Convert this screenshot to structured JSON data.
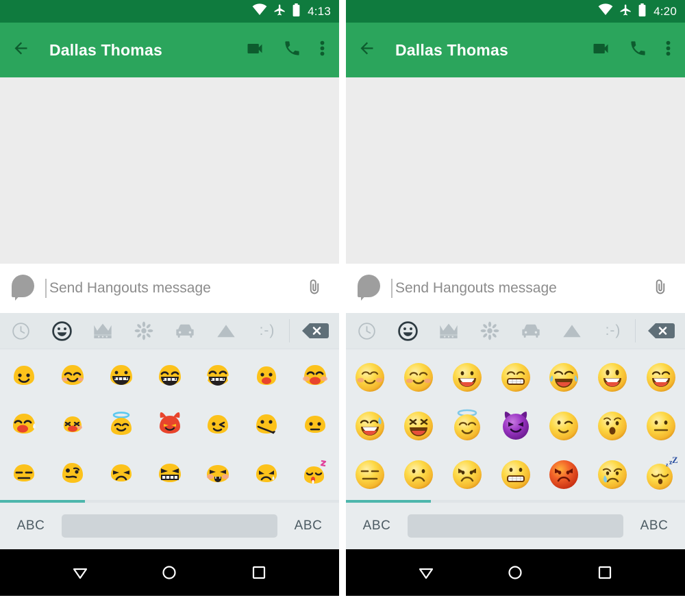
{
  "screens": [
    {
      "id": "left",
      "label": "old-blob-emoji-screen",
      "status": {
        "time": "4:13",
        "wifi_icon": "wifi-icon",
        "airplane_icon": "airplane-mode-icon",
        "battery_icon": "battery-icon"
      },
      "appbar": {
        "back_icon": "back-arrow-icon",
        "title": "Dallas Thomas",
        "video_icon": "video-call-icon",
        "call_icon": "phone-call-icon",
        "overflow_icon": "overflow-menu-icon"
      },
      "compose": {
        "avatar_icon": "avatar-bubble-icon",
        "placeholder": "Send Hangouts message",
        "value": "",
        "attach_icon": "paperclip-icon"
      },
      "keyboard": {
        "categories": [
          {
            "name": "recent-emoji-tab",
            "icon": "clock-icon",
            "active": false
          },
          {
            "name": "smileys-emoji-tab",
            "icon": "smiley-icon",
            "active": true
          },
          {
            "name": "people-emoji-tab",
            "icon": "crown-icon",
            "active": false
          },
          {
            "name": "nature-emoji-tab",
            "icon": "flower-icon",
            "active": false
          },
          {
            "name": "travel-emoji-tab",
            "icon": "car-icon",
            "active": false
          },
          {
            "name": "objects-emoji-tab",
            "icon": "triangle-icon",
            "active": false
          },
          {
            "name": "emoticons-tab",
            "icon": "text-emoticon",
            "label": ":-)",
            "active": false
          }
        ],
        "backspace_icon": "backspace-icon",
        "style": "blob",
        "rows": [
          [
            "slightly-smiling",
            "blush",
            "grin",
            "grin-eyes-closed",
            "joy",
            "open-mouth-smile",
            "laughing-blush"
          ],
          [
            "sweat-smile",
            "squint-laugh",
            "halo",
            "devil-red",
            "wink",
            "zipper-mouth",
            "neutral"
          ],
          [
            "expressionless",
            "confused",
            "angry",
            "grimace-angry",
            "pouting",
            "crying",
            "sleeping"
          ]
        ],
        "left_key_label": "ABC",
        "right_key_label": "ABC",
        "spacebar_label": ""
      },
      "nav": {
        "back_icon": "keyboard-hide-icon",
        "home_icon": "home-circle-icon",
        "recents_icon": "recents-square-icon"
      }
    },
    {
      "id": "right",
      "label": "new-round-emoji-screen",
      "status": {
        "time": "4:20",
        "wifi_icon": "wifi-icon",
        "airplane_icon": "airplane-mode-icon",
        "battery_icon": "battery-icon"
      },
      "appbar": {
        "back_icon": "back-arrow-icon",
        "title": "Dallas Thomas",
        "video_icon": "video-call-icon",
        "call_icon": "phone-call-icon",
        "overflow_icon": "overflow-menu-icon"
      },
      "compose": {
        "avatar_icon": "avatar-bubble-icon",
        "placeholder": "Send Hangouts message",
        "value": "",
        "attach_icon": "paperclip-icon"
      },
      "keyboard": {
        "categories": [
          {
            "name": "recent-emoji-tab",
            "icon": "clock-icon",
            "active": false
          },
          {
            "name": "smileys-emoji-tab",
            "icon": "smiley-icon",
            "active": true
          },
          {
            "name": "people-emoji-tab",
            "icon": "crown-icon",
            "active": false
          },
          {
            "name": "nature-emoji-tab",
            "icon": "flower-icon",
            "active": false
          },
          {
            "name": "travel-emoji-tab",
            "icon": "car-icon",
            "active": false
          },
          {
            "name": "objects-emoji-tab",
            "icon": "triangle-icon",
            "active": false
          },
          {
            "name": "emoticons-tab",
            "icon": "text-emoticon",
            "label": ":-)",
            "active": false
          }
        ],
        "backspace_icon": "backspace-icon",
        "style": "round",
        "rows": [
          [
            "relaxed",
            "blush",
            "smile",
            "grin-teeth",
            "joy",
            "open-mouth-smile",
            "grin"
          ],
          [
            "sweat-smile",
            "squint-laugh",
            "halo",
            "devil-purple",
            "wink",
            "surprised",
            "neutral"
          ],
          [
            "expressionless",
            "slight-frown",
            "angry",
            "grimace",
            "rage-red",
            "crying",
            "sleeping"
          ]
        ],
        "left_key_label": "ABC",
        "right_key_label": "ABC",
        "spacebar_label": ""
      },
      "nav": {
        "back_icon": "keyboard-hide-icon",
        "home_icon": "home-circle-icon",
        "recents_icon": "recents-square-icon"
      }
    }
  ],
  "colors": {
    "status_bar": "#0f7b3e",
    "app_bar": "#2ba55c",
    "conversation_bg": "#ececec",
    "keyboard_bg": "#e8ecee",
    "toolbar_bg": "#e3e8ea",
    "page_indicator": "#4db6ac",
    "nav_bar": "#000000",
    "blob_yellow": "#fcc21b",
    "round_yellow": "#fdd947"
  }
}
